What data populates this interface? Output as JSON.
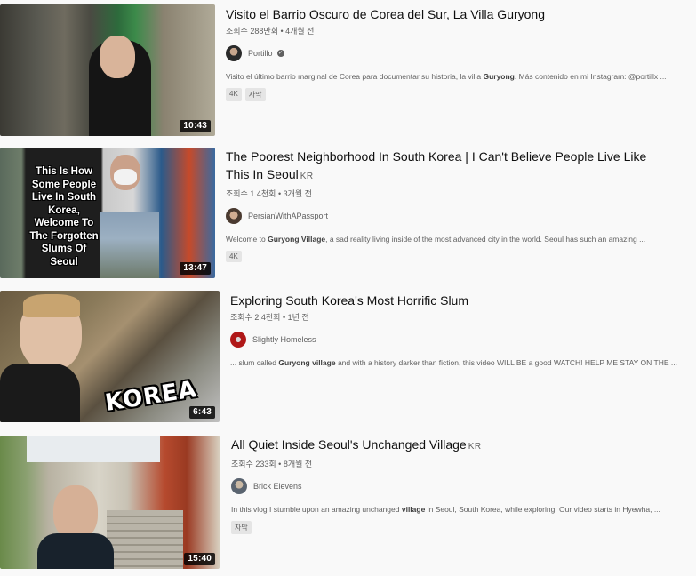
{
  "videos": [
    {
      "title": "Visito el Barrio Oscuro de Corea del Sur, La Villa Guryong",
      "title_suffix": "",
      "views": "조회수 288만회",
      "age": "4개월 전",
      "channel": "Portillo",
      "verified": true,
      "desc_before": "Visito el último barrio marginal de Corea para documentar su historia, la villa ",
      "desc_bold": "Guryong",
      "desc_after": ". Más contenido en mi Instagram: @portillx ...",
      "badges": [
        "4K",
        "자막"
      ],
      "duration": "10:43",
      "thumb_text": ""
    },
    {
      "title": "The Poorest Neighborhood In South Korea | I Can't Believe People Live Like This In Seoul",
      "title_suffix": "KR",
      "views": "조회수 1.4천회",
      "age": "3개월 전",
      "channel": "PersianWithAPassport",
      "verified": false,
      "desc_before": "Welcome to ",
      "desc_bold": "Guryong Village",
      "desc_after": ", a sad reality living inside of the most advanced city in the world. Seoul has such an amazing ...",
      "badges": [
        "4K"
      ],
      "duration": "13:47",
      "thumb_text": "This Is How Some People Live In South Korea, Welcome To The Forgotten Slums Of Seoul"
    },
    {
      "title": "Exploring South Korea's Most Horrific Slum",
      "title_suffix": "",
      "views": "조회수 2.4천회",
      "age": "1년 전",
      "channel": "Slightly Homeless",
      "verified": false,
      "desc_before": "... slum called ",
      "desc_bold": "Guryong village",
      "desc_after": " and with a history darker than fiction, this video WILL BE a good WATCH! HELP ME STAY ON THE ...",
      "badges": [],
      "duration": "6:43",
      "thumb_text": "KOREA"
    },
    {
      "title": "All Quiet Inside Seoul's Unchanged Village",
      "title_suffix": "KR",
      "views": "조회수 233회",
      "age": "8개월 전",
      "channel": "Brick Elevens",
      "verified": false,
      "desc_before": "In this vlog I stumble upon an amazing unchanged ",
      "desc_bold": "village",
      "desc_after": " in Seoul, South Korea, while exploring. Our video starts in Hyewha, ...",
      "badges": [
        "자막"
      ],
      "duration": "15:40",
      "thumb_text": ""
    }
  ],
  "separator": "•"
}
